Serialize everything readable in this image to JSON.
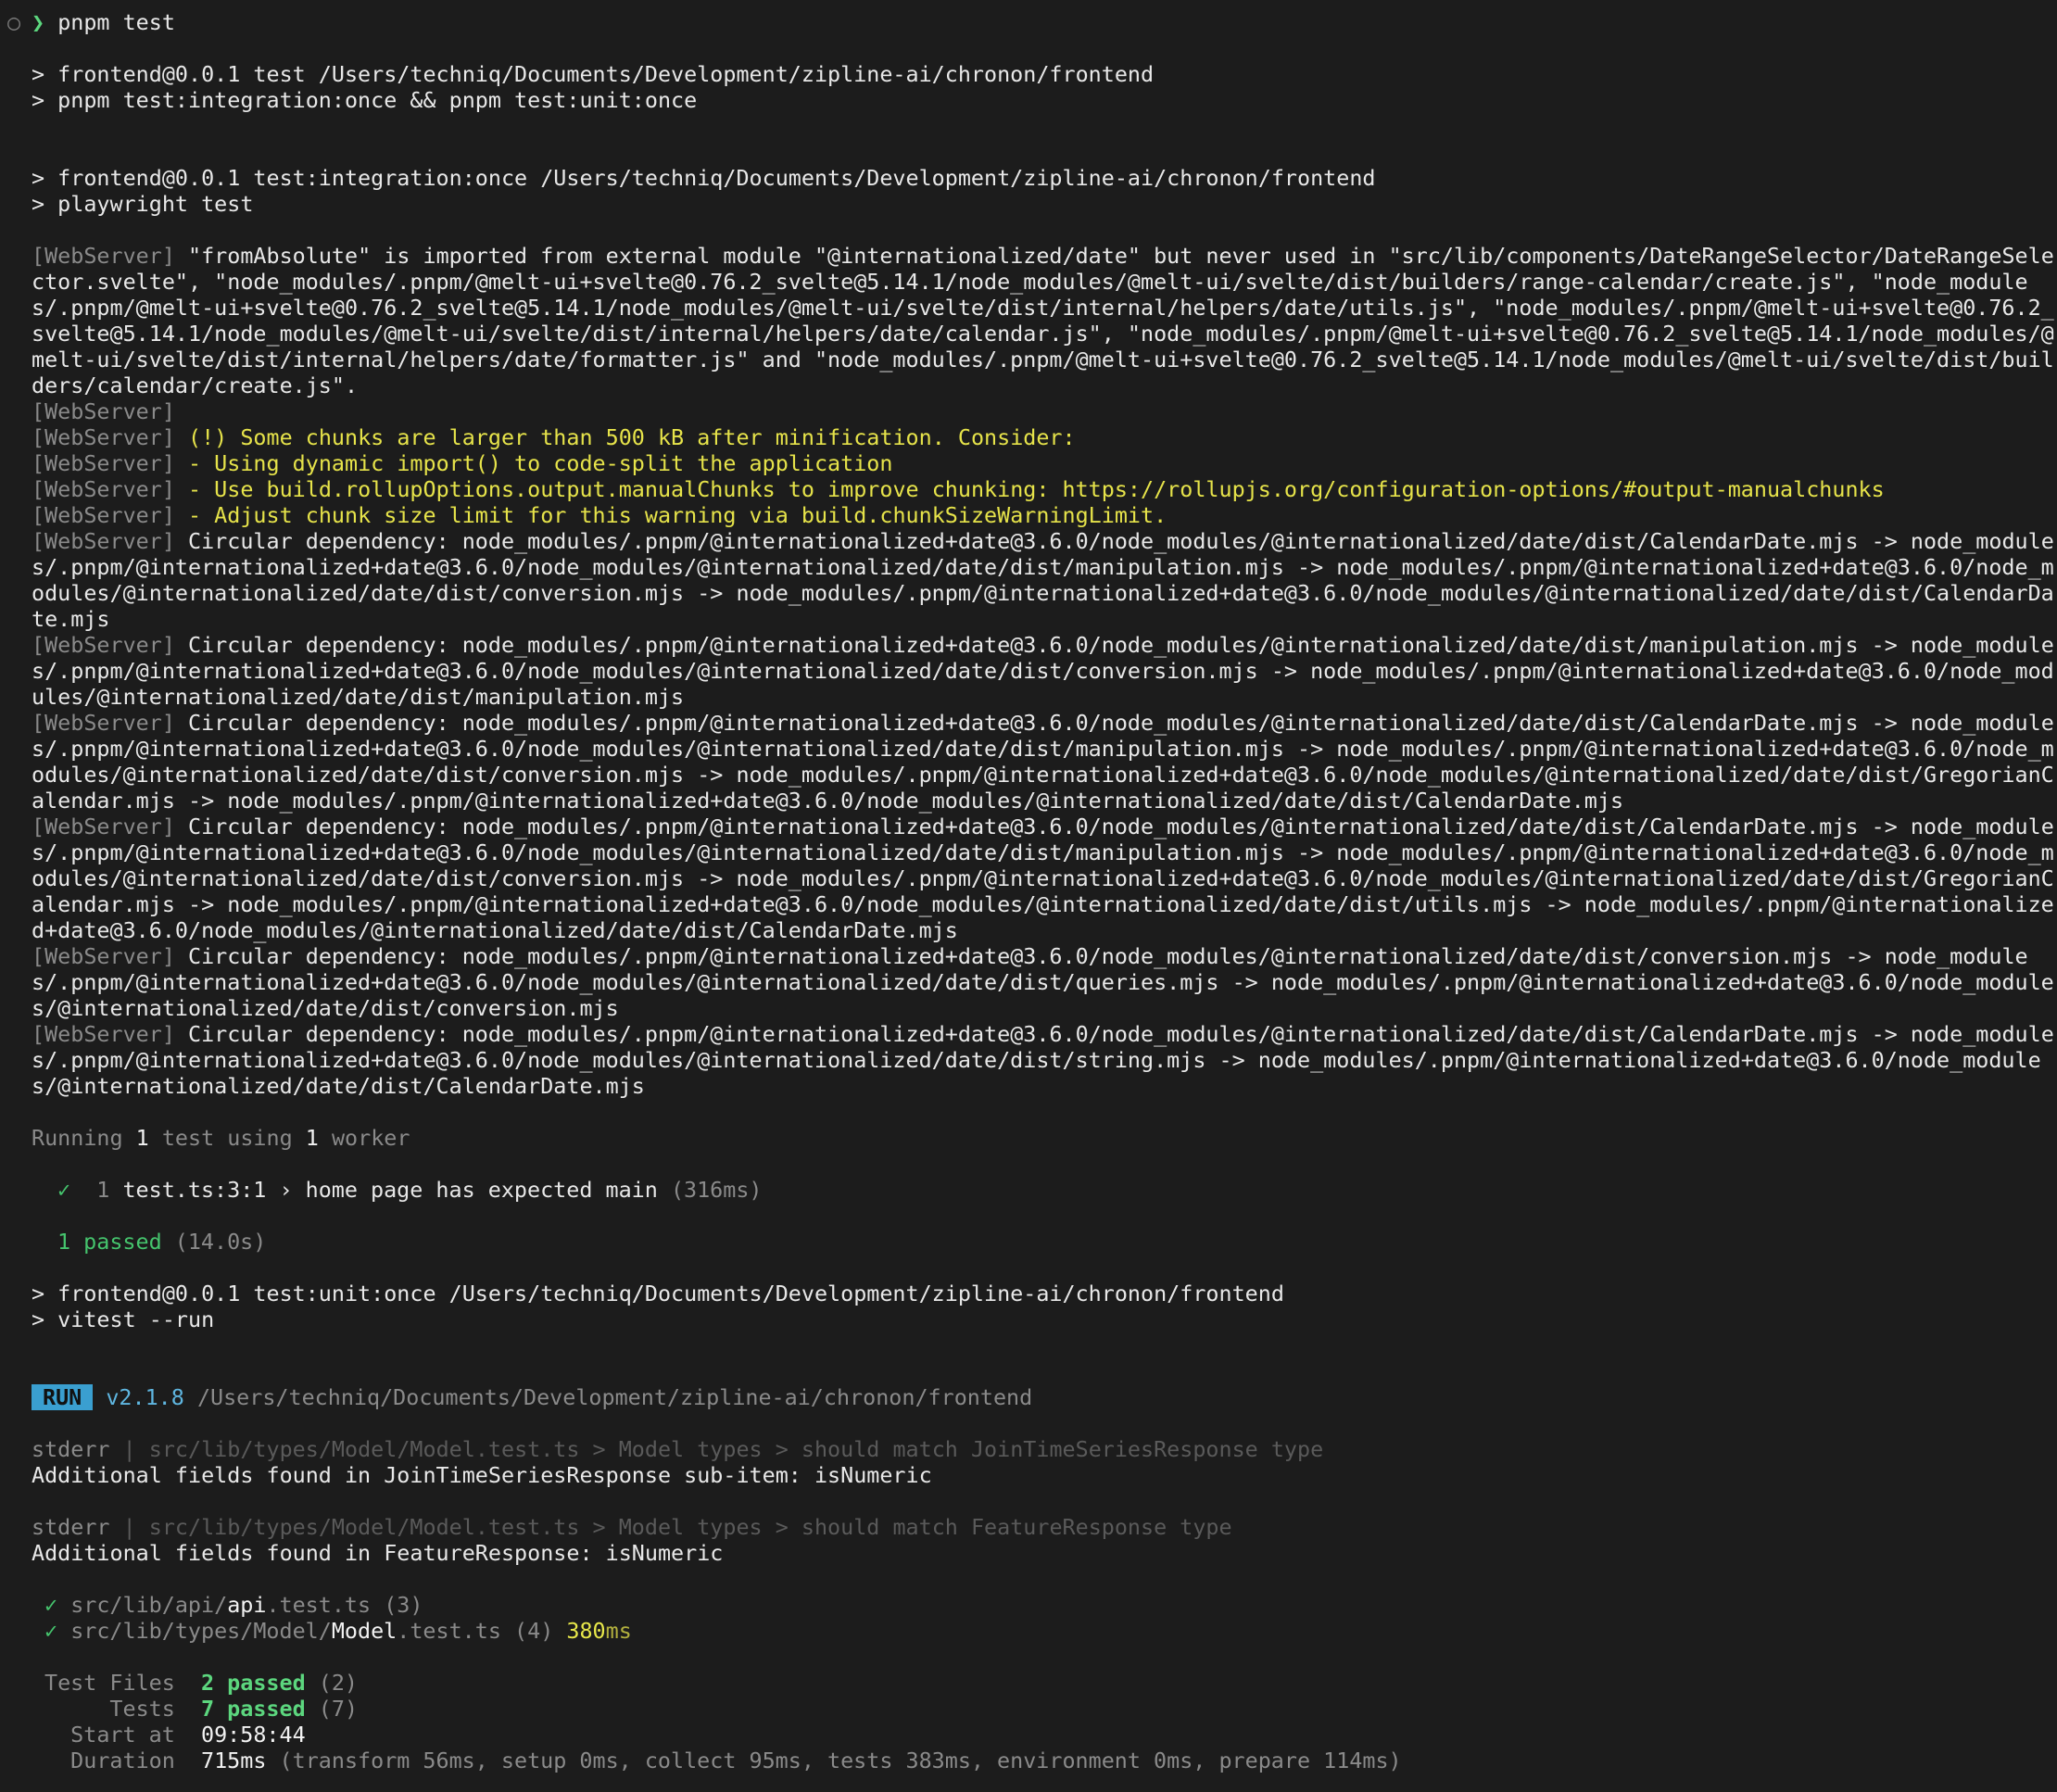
{
  "prompt": {
    "circle": "○",
    "arrow": "❯",
    "command": "pnpm test"
  },
  "script1": {
    "line1": "> frontend@0.0.1 test /Users/techniq/Documents/Development/zipline-ai/chronon/frontend",
    "line2": "> pnpm test:integration:once && pnpm test:unit:once"
  },
  "script2": {
    "line1": "> frontend@0.0.1 test:integration:once /Users/techniq/Documents/Development/zipline-ai/chronon/frontend",
    "line2": "> playwright test"
  },
  "webserver_tag": "[WebServer]",
  "webserver_unused_import": "\"fromAbsolute\" is imported from external module \"@internationalized/date\" but never used in \"src/lib/components/DateRangeSelector/DateRangeSelector.svelte\", \"node_modules/.pnpm/@melt-ui+svelte@0.76.2_svelte@5.14.1/node_modules/@melt-ui/svelte/dist/builders/range-calendar/create.js\", \"node_modules/.pnpm/@melt-ui+svelte@0.76.2_svelte@5.14.1/node_modules/@melt-ui/svelte/dist/internal/helpers/date/utils.js\", \"node_modules/.pnpm/@melt-ui+svelte@0.76.2_svelte@5.14.1/node_modules/@melt-ui/svelte/dist/internal/helpers/date/calendar.js\", \"node_modules/.pnpm/@melt-ui+svelte@0.76.2_svelte@5.14.1/node_modules/@melt-ui/svelte/dist/internal/helpers/date/formatter.js\" and \"node_modules/.pnpm/@melt-ui+svelte@0.76.2_svelte@5.14.1/node_modules/@melt-ui/svelte/dist/builders/calendar/create.js\".",
  "webserver_warnings": [
    "(!) Some chunks are larger than 500 kB after minification. Consider:",
    "- Using dynamic import() to code-split the application",
    "- Use build.rollupOptions.output.manualChunks to improve chunking: https://rollupjs.org/configuration-options/#output-manualchunks",
    "- Adjust chunk size limit for this warning via build.chunkSizeWarningLimit."
  ],
  "circular_deps": [
    "Circular dependency: node_modules/.pnpm/@internationalized+date@3.6.0/node_modules/@internationalized/date/dist/CalendarDate.mjs -> node_modules/.pnpm/@internationalized+date@3.6.0/node_modules/@internationalized/date/dist/manipulation.mjs -> node_modules/.pnpm/@internationalized+date@3.6.0/node_modules/@internationalized/date/dist/conversion.mjs -> node_modules/.pnpm/@internationalized+date@3.6.0/node_modules/@internationalized/date/dist/CalendarDate.mjs",
    "Circular dependency: node_modules/.pnpm/@internationalized+date@3.6.0/node_modules/@internationalized/date/dist/manipulation.mjs -> node_modules/.pnpm/@internationalized+date@3.6.0/node_modules/@internationalized/date/dist/conversion.mjs -> node_modules/.pnpm/@internationalized+date@3.6.0/node_modules/@internationalized/date/dist/manipulation.mjs",
    "Circular dependency: node_modules/.pnpm/@internationalized+date@3.6.0/node_modules/@internationalized/date/dist/CalendarDate.mjs -> node_modules/.pnpm/@internationalized+date@3.6.0/node_modules/@internationalized/date/dist/manipulation.mjs -> node_modules/.pnpm/@internationalized+date@3.6.0/node_modules/@internationalized/date/dist/conversion.mjs -> node_modules/.pnpm/@internationalized+date@3.6.0/node_modules/@internationalized/date/dist/GregorianCalendar.mjs -> node_modules/.pnpm/@internationalized+date@3.6.0/node_modules/@internationalized/date/dist/CalendarDate.mjs",
    "Circular dependency: node_modules/.pnpm/@internationalized+date@3.6.0/node_modules/@internationalized/date/dist/CalendarDate.mjs -> node_modules/.pnpm/@internationalized+date@3.6.0/node_modules/@internationalized/date/dist/manipulation.mjs -> node_modules/.pnpm/@internationalized+date@3.6.0/node_modules/@internationalized/date/dist/conversion.mjs -> node_modules/.pnpm/@internationalized+date@3.6.0/node_modules/@internationalized/date/dist/GregorianCalendar.mjs -> node_modules/.pnpm/@internationalized+date@3.6.0/node_modules/@internationalized/date/dist/utils.mjs -> node_modules/.pnpm/@internationalized+date@3.6.0/node_modules/@internationalized/date/dist/CalendarDate.mjs",
    "Circular dependency: node_modules/.pnpm/@internationalized+date@3.6.0/node_modules/@internationalized/date/dist/conversion.mjs -> node_modules/.pnpm/@internationalized+date@3.6.0/node_modules/@internationalized/date/dist/queries.mjs -> node_modules/.pnpm/@internationalized+date@3.6.0/node_modules/@internationalized/date/dist/conversion.mjs",
    "Circular dependency: node_modules/.pnpm/@internationalized+date@3.6.0/node_modules/@internationalized/date/dist/CalendarDate.mjs -> node_modules/.pnpm/@internationalized+date@3.6.0/node_modules/@internationalized/date/dist/string.mjs -> node_modules/.pnpm/@internationalized+date@3.6.0/node_modules/@internationalized/date/dist/CalendarDate.mjs"
  ],
  "playwright": {
    "running_prefix": "Running ",
    "running_count": "1",
    "running_mid": " test using ",
    "running_workers": "1",
    "running_suffix": " worker",
    "check": "✓",
    "index": "1",
    "test_name": "test.ts:3:1 › home page has expected main",
    "test_time": "(316ms)",
    "passed": "1 passed",
    "passed_time": "(14.0s)"
  },
  "script3": {
    "line1": "> frontend@0.0.1 test:unit:once /Users/techniq/Documents/Development/zipline-ai/chronon/frontend",
    "line2": "> vitest --run"
  },
  "vitest": {
    "badge": "RUN",
    "version": "v2.1.8",
    "path": "/Users/techniq/Documents/Development/zipline-ai/chronon/frontend",
    "stderr_label": "stderr",
    "stderr1_path": "| src/lib/types/Model/Model.test.ts > Model types > should match JoinTimeSeriesResponse type",
    "stderr1_msg": "Additional fields found in JoinTimeSeriesResponse sub-item: isNumeric",
    "stderr2_path": "| src/lib/types/Model/Model.test.ts > Model types > should match FeatureResponse type",
    "stderr2_msg": "Additional fields found in FeatureResponse: isNumeric",
    "check": "✓",
    "file1_dir": "src/lib/api/",
    "file1_name": "api",
    "file1_ext": ".test.ts",
    "file1_count": "(3)",
    "file2_dir": "src/lib/types/Model/",
    "file2_name": "Model",
    "file2_ext": ".test.ts",
    "file2_count": "(4)",
    "file2_time_num": "380",
    "file2_time_unit": "ms",
    "summary": {
      "files_label": "Test Files",
      "files_passed": "2 passed",
      "files_total": "(2)",
      "tests_label": "Tests",
      "tests_passed": "7 passed",
      "tests_total": "(7)",
      "start_label": "Start at",
      "start_value": "09:58:44",
      "duration_label": "Duration",
      "duration_value": "715ms",
      "duration_detail": "(transform 56ms, setup 0ms, collect 95ms, tests 383ms, environment 0ms, prepare 114ms)"
    }
  },
  "colors": {
    "background": "#1c1c1c",
    "prompt_green": "#5cd67e",
    "warning_yellow": "#e6e34a",
    "badge_blue": "#3a9fd0"
  }
}
